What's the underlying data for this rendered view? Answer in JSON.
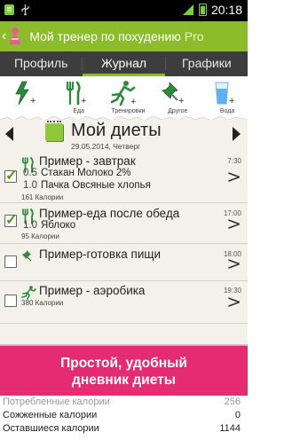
{
  "status_bar": {
    "time": "20:18"
  },
  "app": {
    "title": "Мой тренер по похудению",
    "title_suffix": "Pro",
    "accent_color": "#8cbc2c"
  },
  "tabs": [
    {
      "label": "Профиль",
      "active": false
    },
    {
      "label": "Журнал",
      "active": true
    },
    {
      "label": "Графики",
      "active": false
    }
  ],
  "quick_add": [
    {
      "icon": "quick-add-icon",
      "label": ""
    },
    {
      "icon": "fork-knife-icon",
      "label": "Еда"
    },
    {
      "icon": "runner-icon",
      "label": "Тренировки"
    },
    {
      "icon": "pin-icon",
      "label": "Другое"
    },
    {
      "icon": "water-glass-icon",
      "label": "Вода"
    }
  ],
  "diary": {
    "title": "Мой диеты",
    "date": "29.05.2014, Четверг"
  },
  "meals": [
    {
      "name": "Пример - завтрак",
      "time": "7:30",
      "checked": true,
      "icon": "fork-knife-icon",
      "items": [
        {
          "qty": "0.5",
          "name": "Стакан Молоко 2%"
        },
        {
          "qty": "1.0",
          "name": "Пачка Овсяные хлопья"
        }
      ],
      "calories": "161 Калории"
    },
    {
      "name": "Пример-еда после обеда",
      "time": "17:00",
      "checked": true,
      "icon": "fork-knife-icon",
      "items": [
        {
          "qty": "1.0",
          "name": "Яблоко"
        }
      ],
      "calories": "95 Калории"
    },
    {
      "name": "Пример-готовка пищи",
      "time": "18:00",
      "checked": false,
      "icon": "pin-icon",
      "items": [],
      "calories": ""
    },
    {
      "name": "Пример - аэробика",
      "time": "19:30",
      "checked": false,
      "icon": "runner-icon",
      "items": [],
      "calories": "380 Калории"
    }
  ],
  "promo": {
    "line1": "Простой, удобный",
    "line2": "дневник диеты",
    "color": "#e52c72"
  },
  "summary": [
    {
      "label": "Потребленные калории",
      "value": "256"
    },
    {
      "label": "Сожженные калории",
      "value": "0"
    },
    {
      "label": "Оставшиеся калории",
      "value": "1144"
    }
  ]
}
